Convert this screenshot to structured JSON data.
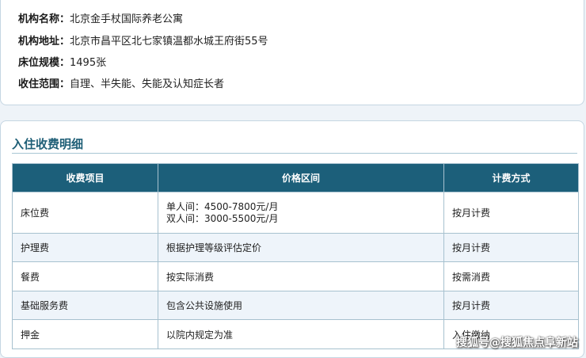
{
  "info": {
    "name_label": "机构名称：",
    "name_value": "北京金手杖国际养老公寓",
    "address_label": "机构地址：",
    "address_value": "北京市昌平区北七家镇温都水城王府街55号",
    "beds_label": "床位规模：",
    "beds_value": "1495张",
    "scope_label": "收住范围：",
    "scope_value": "自理、半失能、失能及认知症长者"
  },
  "fees": {
    "title": "入住收费明细",
    "headers": [
      "收费项目",
      "价格区间",
      "计费方式"
    ],
    "rows": [
      {
        "item": "床位费",
        "price": [
          "单人间：4500-7800元/月",
          "双人间：3000-5500元/月"
        ],
        "billing": "按月计费"
      },
      {
        "item": "护理费",
        "price": [
          "根据护理等级评估定价"
        ],
        "billing": "按月计费"
      },
      {
        "item": "餐费",
        "price": [
          "按实际消费"
        ],
        "billing": "按需消费"
      },
      {
        "item": "基础服务费",
        "price": [
          "包含公共设施使用"
        ],
        "billing": "按月计费"
      },
      {
        "item": "押金",
        "price": [
          "以院内规定为准"
        ],
        "billing": "入住缴纳"
      }
    ]
  },
  "watermark": "搜狐号@搜狐焦点阜新站"
}
